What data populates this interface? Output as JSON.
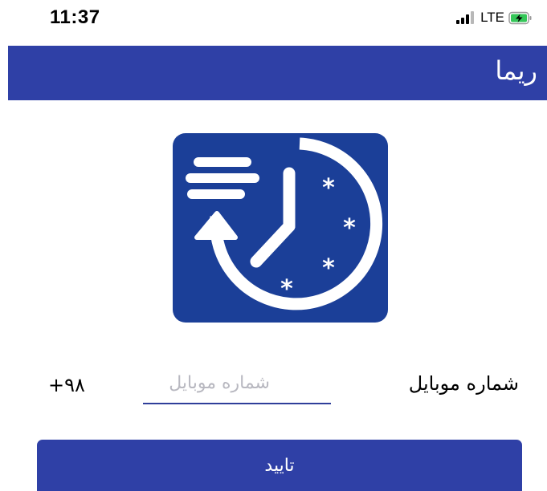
{
  "status_bar": {
    "time": "11:37",
    "network": "LTE",
    "icons": [
      "signal-icon",
      "battery-charging-icon"
    ]
  },
  "app_bar": {
    "title": "ریما",
    "color": "#2f40a6"
  },
  "logo": {
    "icon": "clock-history-snowflake-icon",
    "color": "#1b3f98"
  },
  "login_form": {
    "phone_label": "شماره موبایل",
    "phone_placeholder": "شماره موبایل",
    "phone_value": "",
    "country_code": "+۹۸",
    "submit_label": "تایید"
  }
}
